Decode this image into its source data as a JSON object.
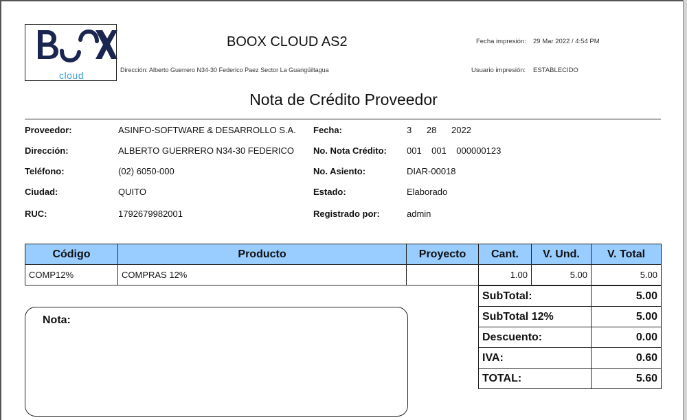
{
  "logo": {
    "text": "BOOX",
    "sub": "cloud",
    "color": "#1a2550",
    "accent": "#3aa0d8"
  },
  "header": {
    "company": "BOOX CLOUD AS2",
    "address": "Dirección: Alberto Guerrero N34-30 Federico Paez Sector La Guangüiltagua",
    "print_date_label": "Fecha impresión:",
    "print_date_value": "29 Mar 2022 / 4:54 PM",
    "print_user_label": "Usuario impresión:",
    "print_user_value": "ESTABLECIDO"
  },
  "title": "Nota de Crédito Proveedor",
  "fields_left": [
    {
      "label": "Proveedor:",
      "value": "ASINFO-SOFTWARE & DESARROLLO S.A."
    },
    {
      "label": "Dirección:",
      "value": "ALBERTO GUERRERO N34-30 FEDERICO"
    },
    {
      "label": "Teléfono:",
      "value": "(02) 6050-000"
    },
    {
      "label": "Ciudad:",
      "value": "QUITO"
    },
    {
      "label": "RUC:",
      "value": "1792679982001"
    }
  ],
  "fields_right": [
    {
      "label": "Fecha:",
      "value": "3      28      2022"
    },
    {
      "label": "No. Nota Crédito:",
      "value": "001    001    000000123"
    },
    {
      "label": "No. Asiento:",
      "value": "DIAR-00018"
    },
    {
      "label": "Estado:",
      "value": "Elaborado"
    },
    {
      "label": "Registrado por:",
      "value": "admin"
    }
  ],
  "table": {
    "headers": [
      "Código",
      "Producto",
      "Proyecto",
      "Cant.",
      "V. Und.",
      "V. Total"
    ],
    "rows": [
      [
        "COMP12%",
        "COMPRAS 12%",
        "",
        "1.00",
        "5.00",
        "5.00"
      ]
    ]
  },
  "totals": [
    {
      "label": "SubTotal:",
      "value": "5.00"
    },
    {
      "label": "SubTotal 12%",
      "value": "5.00"
    },
    {
      "label": "Descuento:",
      "value": "0.00"
    },
    {
      "label": "IVA:",
      "value": "0.60"
    },
    {
      "label": "TOTAL:",
      "value": "5.60"
    }
  ],
  "note": {
    "label": "Nota:"
  },
  "colors": {
    "header_bg": "#99ccff"
  }
}
